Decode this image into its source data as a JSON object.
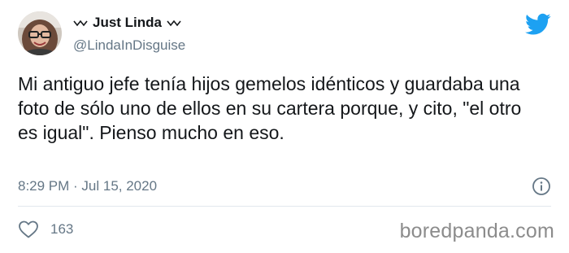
{
  "user": {
    "display_name": "Just Linda",
    "handle": "@LindaInDisguise"
  },
  "tweet": {
    "text": "Mi antiguo jefe tenía hijos gemelos idénticos y guardaba una foto de sólo uno de ellos en su cartera porque, y cito, \"el otro es igual\". Pienso mucho en eso.",
    "timestamp": "8:29 PM · Jul 15, 2020"
  },
  "engagement": {
    "like_count": "163"
  },
  "icons": {
    "brand": "twitter-bird-icon",
    "info": "info-icon",
    "like": "heart-icon"
  },
  "watermark": "boredpanda.com",
  "colors": {
    "twitter_blue": "#1da1f2",
    "secondary_text": "#657786",
    "primary_text": "#14171a",
    "divider": "#e1e8ed"
  }
}
